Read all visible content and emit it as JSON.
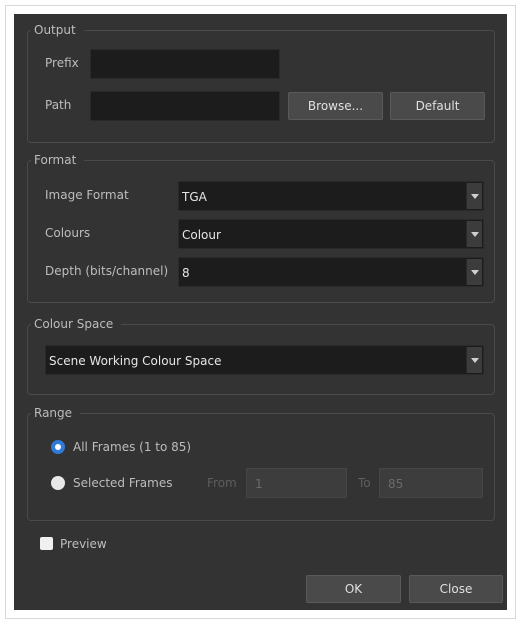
{
  "output": {
    "title": "Output",
    "prefix_label": "Prefix",
    "prefix_value": "",
    "path_label": "Path",
    "path_value": "",
    "browse_label": "Browse...",
    "default_label": "Default"
  },
  "format": {
    "title": "Format",
    "image_format_label": "Image Format",
    "image_format_value": "TGA",
    "colours_label": "Colours",
    "colours_value": "Colour",
    "depth_label": "Depth (bits/channel)",
    "depth_value": "8"
  },
  "colour_space": {
    "title": "Colour Space",
    "value": "Scene Working Colour Space"
  },
  "range": {
    "title": "Range",
    "all_frames_label": "All Frames (1 to 85)",
    "all_frames_selected": true,
    "selected_frames_label": "Selected Frames",
    "from_label": "From",
    "from_value": "1",
    "to_label": "To",
    "to_value": "85"
  },
  "preview": {
    "label": "Preview",
    "checked": false
  },
  "buttons": {
    "ok_label": "OK",
    "close_label": "Close"
  },
  "colors": {
    "panel": "#333333",
    "field": "#1c1c1c",
    "accent": "#2f7bd6"
  },
  "icons": {
    "dropdown": "chevron-down-icon",
    "radio": "radio-icon",
    "checkbox": "checkbox-icon"
  }
}
